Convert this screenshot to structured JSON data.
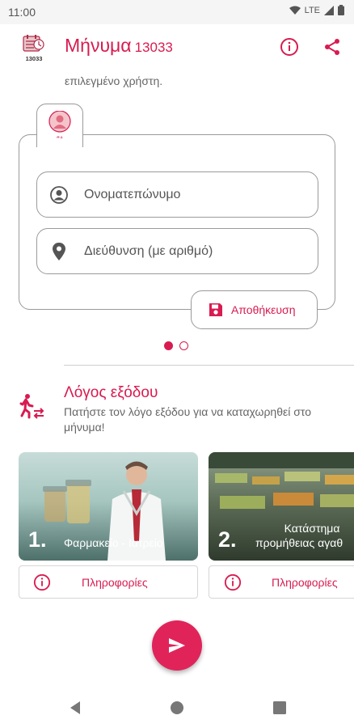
{
  "status_bar": {
    "time": "11:00",
    "network": "LTE"
  },
  "app_bar": {
    "title": "Μήνυμα",
    "number": "13033",
    "logo_text": "13033",
    "info_icon": "info-icon",
    "share_icon": "share-icon"
  },
  "user_section": {
    "truncated_text": "επιλεγμένο χρήστη.",
    "user_tab_label": "#1",
    "name_placeholder": "Ονοματεπώνυμο",
    "address_placeholder": "Διεύθυνση (με αριθμό)",
    "save_label": "Αποθήκευση",
    "page_dots": {
      "count": 2,
      "active_index": 0
    }
  },
  "exit_reason": {
    "title": "Λόγος εξόδου",
    "description": "Πατήστε τον λόγο εξόδου για να καταχωρηθεί στο μήνυμα!"
  },
  "reason_cards": [
    {
      "number": "1.",
      "title": "Φαρμακείο - Ιατρείο",
      "info_label": "Πληροφορίες"
    },
    {
      "number": "2.",
      "title_line1": "Κατάστημα",
      "title_line2": "προμήθειας αγαθ",
      "info_label": "Πληροφορίες"
    }
  ],
  "colors": {
    "accent": "#d81b50",
    "fab": "#e0245a"
  }
}
